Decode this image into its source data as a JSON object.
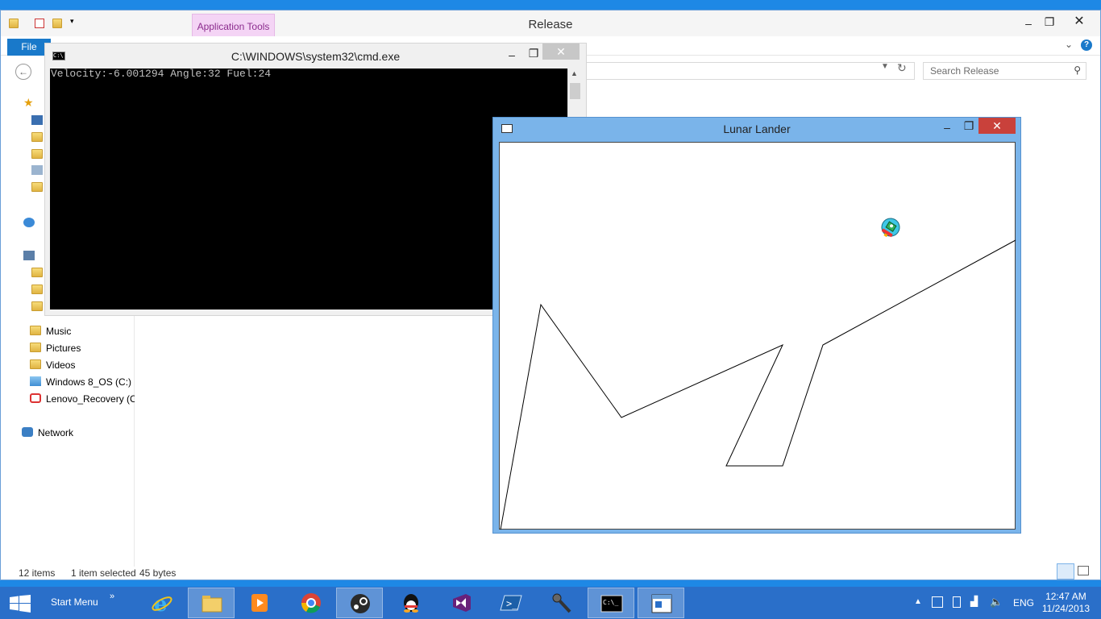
{
  "explorer": {
    "title": "Release",
    "context_tab": "Application Tools",
    "file_tab": "File",
    "search_placeholder": "Search Release",
    "nav_items": [
      {
        "label": "Music",
        "icon": "music-folder-icon"
      },
      {
        "label": "Pictures",
        "icon": "pictures-folder-icon"
      },
      {
        "label": "Videos",
        "icon": "videos-folder-icon"
      },
      {
        "label": "Windows 8_OS (C:)",
        "icon": "drive-icon"
      },
      {
        "label": "Lenovo_Recovery (C",
        "icon": "recovery-drive-icon"
      },
      {
        "label": "Network",
        "icon": "network-icon"
      }
    ],
    "status": {
      "item_count": "12 items",
      "selection": "1 item selected",
      "size": "45 bytes"
    }
  },
  "cmd": {
    "title": "C:\\WINDOWS\\system32\\cmd.exe",
    "output": "Velocity:-6.001294 Angle:32 Fuel:24"
  },
  "lander": {
    "title": "Lunar Lander"
  },
  "taskbar": {
    "start_label": "Start Menu",
    "pinned": [
      "internet-explorer-icon",
      "file-explorer-icon",
      "media-player-icon",
      "chrome-icon",
      "steam-icon",
      "qq-icon",
      "visual-studio-icon",
      "powershell-icon",
      "microphone-icon",
      "cmd-icon",
      "app-window-icon"
    ],
    "language": "ENG",
    "time": "12:47 AM",
    "date": "11/24/2013"
  },
  "colors": {
    "desktop": "#1e88e5",
    "taskbar": "#2a6fc9",
    "lander_frame": "#7ab4ea",
    "close_button": "#c9413b",
    "context_tab": "#f4d4f5"
  }
}
